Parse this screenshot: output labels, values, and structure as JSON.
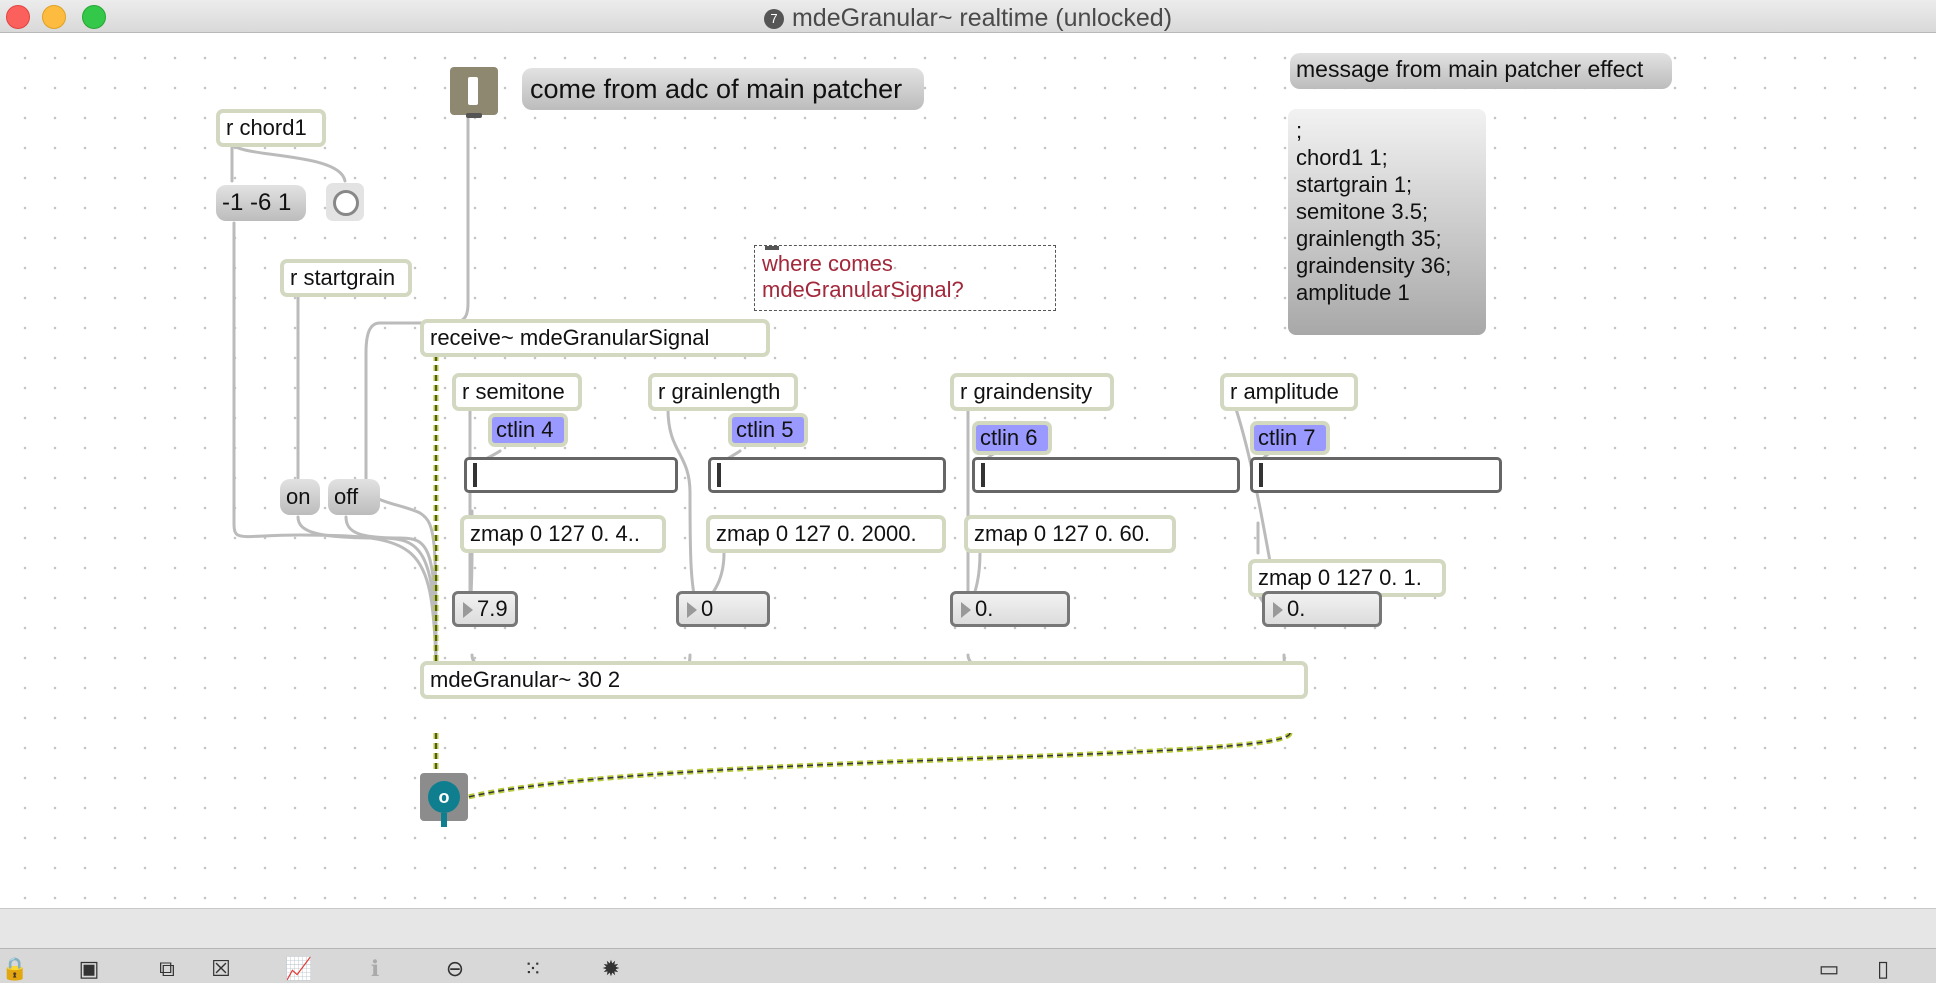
{
  "window": {
    "title": "mdeGranular~ realtime (unlocked)",
    "controls": [
      "close",
      "minimize",
      "zoom"
    ]
  },
  "colors": {
    "object_border": "#d2d9c0",
    "ctlin_fill": "#9999ff",
    "comment_text": "#a2283b",
    "signal_wire": "#b8c93a",
    "wire": "#bbbbbb",
    "title_text": "#4a4a4a"
  },
  "patch": {
    "objects": {
      "r_chord1": "r chord1",
      "chord_msg": "-1 -6 1",
      "r_startgrain": "r startgrain",
      "on_msg": "on",
      "off_msg": "off",
      "receive_signal": "receive~ mdeGranularSignal",
      "r_semitone": "r semitone",
      "r_grainlength": "r grainlength",
      "r_graindensity": "r graindensity",
      "r_amplitude": "r amplitude",
      "ctlin4": "ctlin 4",
      "ctlin5": "ctlin 5",
      "ctlin6": "ctlin 6",
      "ctlin7": "ctlin 7",
      "zmap1": "zmap 0 127 0. 4..",
      "zmap2": "zmap 0 127 0. 2000.",
      "zmap3": "zmap 0 127 0. 60.",
      "zmap4": "zmap 0 127 0. 1.",
      "num1": "7.9",
      "num2": "0",
      "num3": "0.",
      "num4": "0.",
      "granular": "mdeGranular~ 30 2"
    },
    "comments": {
      "adc_comment": "come from adc of main patcher",
      "main_effect_comment": "message from main patcher effect",
      "question_line1": "where comes",
      "question_line2": "mdeGranularSignal?"
    },
    "effect_message_lines": [
      ";",
      "chord1 1;",
      "startgrain 1;",
      "semitone 3.5;",
      "grainlength 35;",
      "graindensity 36;",
      "amplitude 1"
    ]
  },
  "toolbar": {
    "buttons": [
      "lock-icon",
      "new-object-icon",
      "presentation-icon",
      "close-patcher-icon",
      "debug-icon",
      "info-icon",
      "mixer-icon",
      "grid-icon",
      "snippets-icon",
      "left-panel-icon",
      "right-panel-icon"
    ]
  }
}
